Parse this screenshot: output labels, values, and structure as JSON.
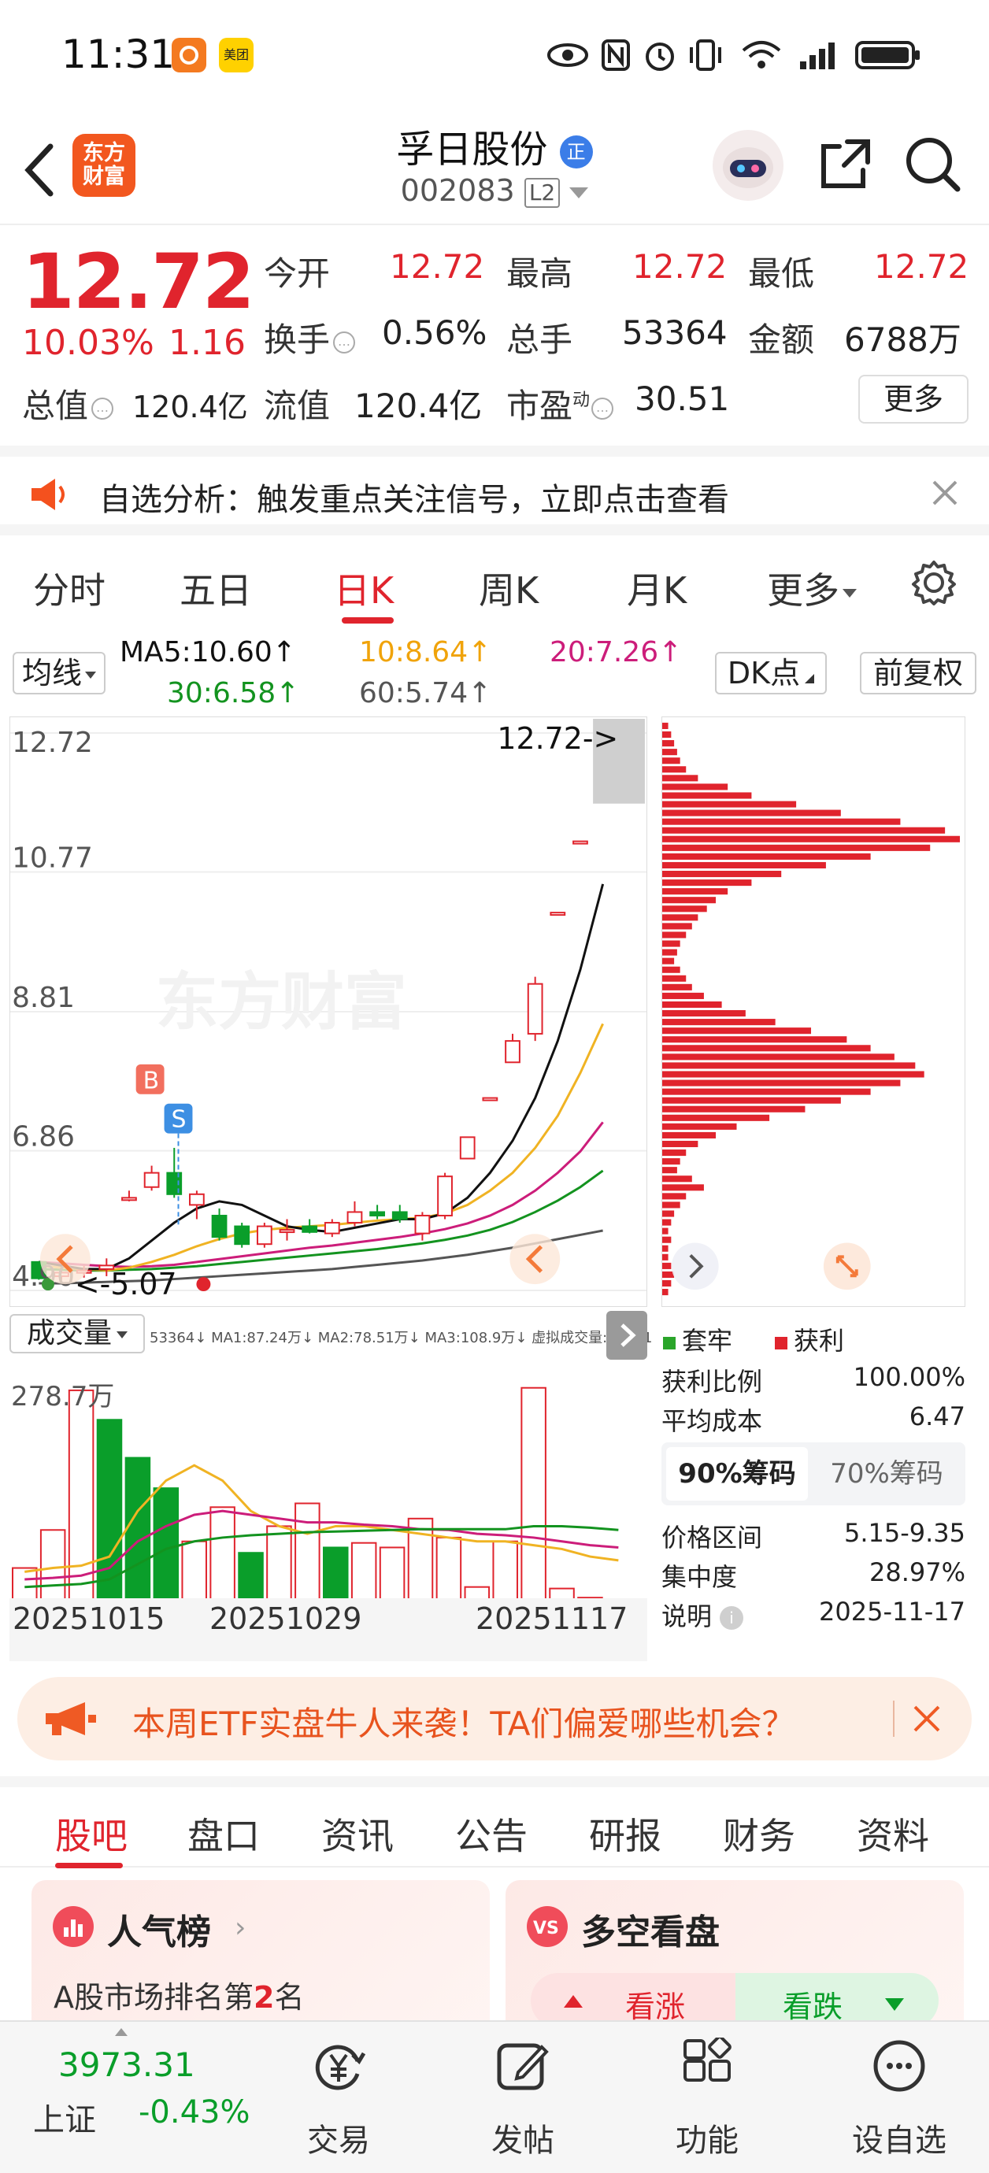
{
  "status_bar": {
    "time": "11:31",
    "app_badge_2_text": "美团"
  },
  "header": {
    "app_logo_text": "东方财富",
    "stock_name": "孚日股份",
    "stock_badge": "正",
    "stock_code": "002083",
    "level_badge": "L2"
  },
  "quote": {
    "price": "12.72",
    "change_pct": "10.03%",
    "change_amt": "1.16",
    "open_label": "今开",
    "open": "12.72",
    "high_label": "最高",
    "high": "12.72",
    "low_label": "最低",
    "low": "12.72",
    "turnover_label": "换手",
    "turnover": "0.56%",
    "volume_label": "总手",
    "volume": "53364",
    "amount_label": "金额",
    "amount": "6788万",
    "mktcap_label": "总值",
    "mktcap": "120.4亿",
    "float_label": "流值",
    "float_cap": "120.4亿",
    "pe_label": "市盈",
    "pe_super": "动",
    "pe": "30.51",
    "more_label": "更多"
  },
  "notice": {
    "text": "自选分析：触发重点关注信号，立即点击查看"
  },
  "period_tabs": [
    "分时",
    "五日",
    "日K",
    "周K",
    "月K",
    "更多"
  ],
  "period_active": "日K",
  "ma_legend": {
    "selector": "均线",
    "ma5": "MA5:10.60↑",
    "ma10": "10:8.64↑",
    "ma20": "20:7.26↑",
    "ma30": "30:6.58↑",
    "ma60": "60:5.74↑",
    "dk_button": "DK点",
    "adjust_button": "前复权"
  },
  "colors": {
    "up": "#e0242d",
    "down": "#0a9e2a",
    "ma5": "#111111",
    "ma10": "#f0b323",
    "ma20": "#cc1d7a",
    "ma30": "#13931f",
    "ma60": "#555555",
    "accent": "#e8531e"
  },
  "kline": {
    "price_labels": [
      "12.72",
      "10.77",
      "8.81",
      "6.86",
      "4.90"
    ],
    "last_price_tag": "12.72->",
    "low_tag": "<-5.07",
    "buy_marker": "B",
    "sell_marker": "S",
    "watermark": "东方财富",
    "candles": [
      {
        "o": 5.3,
        "h": 5.3,
        "l": 5.05,
        "c": 5.07
      },
      {
        "o": 5.1,
        "h": 5.2,
        "l": 5.05,
        "c": 5.15
      },
      {
        "o": 5.15,
        "h": 5.25,
        "l": 5.08,
        "c": 5.18
      },
      {
        "o": 5.2,
        "h": 5.35,
        "l": 5.1,
        "c": 5.25
      },
      {
        "o": 6.2,
        "h": 6.3,
        "l": 6.15,
        "c": 6.2
      },
      {
        "o": 6.35,
        "h": 6.65,
        "l": 6.3,
        "c": 6.55
      },
      {
        "o": 6.55,
        "h": 6.9,
        "l": 6.2,
        "c": 6.25
      },
      {
        "o": 6.1,
        "h": 6.3,
        "l": 5.9,
        "c": 6.25
      },
      {
        "o": 5.95,
        "h": 6.05,
        "l": 5.6,
        "c": 5.65
      },
      {
        "o": 5.8,
        "h": 5.85,
        "l": 5.5,
        "c": 5.55
      },
      {
        "o": 5.55,
        "h": 5.85,
        "l": 5.5,
        "c": 5.8
      },
      {
        "o": 5.75,
        "h": 5.9,
        "l": 5.6,
        "c": 5.75
      },
      {
        "o": 5.8,
        "h": 5.9,
        "l": 5.7,
        "c": 5.72
      },
      {
        "o": 5.7,
        "h": 5.9,
        "l": 5.65,
        "c": 5.85
      },
      {
        "o": 5.85,
        "h": 6.15,
        "l": 5.8,
        "c": 6.0
      },
      {
        "o": 6.0,
        "h": 6.1,
        "l": 5.9,
        "c": 5.95
      },
      {
        "o": 6.0,
        "h": 6.1,
        "l": 5.85,
        "c": 5.9
      },
      {
        "o": 5.7,
        "h": 6.0,
        "l": 5.6,
        "c": 5.95
      },
      {
        "o": 5.95,
        "h": 6.55,
        "l": 5.9,
        "c": 6.5
      },
      {
        "o": 6.75,
        "h": 7.05,
        "l": 6.75,
        "c": 7.05
      },
      {
        "o": 7.6,
        "h": 7.6,
        "l": 7.6,
        "c": 7.6
      },
      {
        "o": 8.1,
        "h": 8.5,
        "l": 8.1,
        "c": 8.4
      },
      {
        "o": 8.5,
        "h": 9.3,
        "l": 8.4,
        "c": 9.2
      },
      {
        "o": 10.2,
        "h": 10.2,
        "l": 10.2,
        "c": 10.2
      },
      {
        "o": 11.2,
        "h": 11.2,
        "l": 11.2,
        "c": 11.2
      },
      {
        "o": 12.72,
        "h": 12.72,
        "l": 12.72,
        "c": 12.72
      }
    ],
    "ma5": [
      5.3,
      5.25,
      5.2,
      5.2,
      5.35,
      5.6,
      5.85,
      6.05,
      6.15,
      6.1,
      5.95,
      5.8,
      5.75,
      5.72,
      5.78,
      5.84,
      5.9,
      5.9,
      5.98,
      6.2,
      6.55,
      7.0,
      7.6,
      8.4,
      9.4,
      10.6
    ],
    "ma10": [
      5.25,
      5.22,
      5.2,
      5.18,
      5.22,
      5.3,
      5.4,
      5.52,
      5.62,
      5.7,
      5.75,
      5.78,
      5.8,
      5.82,
      5.85,
      5.88,
      5.9,
      5.92,
      5.98,
      6.1,
      6.3,
      6.55,
      6.9,
      7.35,
      7.95,
      8.64
    ],
    "ma20": [
      5.3,
      5.28,
      5.26,
      5.24,
      5.23,
      5.24,
      5.26,
      5.3,
      5.34,
      5.38,
      5.42,
      5.46,
      5.5,
      5.53,
      5.57,
      5.61,
      5.65,
      5.7,
      5.76,
      5.84,
      5.95,
      6.1,
      6.3,
      6.55,
      6.85,
      7.26
    ],
    "ma30": [
      5.2,
      5.19,
      5.18,
      5.18,
      5.19,
      5.2,
      5.22,
      5.24,
      5.27,
      5.3,
      5.33,
      5.36,
      5.39,
      5.42,
      5.45,
      5.48,
      5.52,
      5.56,
      5.61,
      5.67,
      5.75,
      5.86,
      6.0,
      6.16,
      6.35,
      6.58
    ],
    "ma60": [
      5.0,
      5.0,
      5.01,
      5.02,
      5.03,
      5.04,
      5.06,
      5.08,
      5.1,
      5.12,
      5.14,
      5.16,
      5.18,
      5.2,
      5.23,
      5.26,
      5.29,
      5.32,
      5.36,
      5.4,
      5.45,
      5.5,
      5.56,
      5.62,
      5.68,
      5.74
    ]
  },
  "volume": {
    "selector": "成交量",
    "legend": "53364↓ MA1:87.24万↓ MA2:78.51万↓ MA3:108.9万↓ 虚拟成交量:71881",
    "max_label": "278.7万",
    "bars": [
      {
        "v": 45,
        "up": true
      },
      {
        "v": 95,
        "up": true
      },
      {
        "v": 278.7,
        "up": true
      },
      {
        "v": 240,
        "up": false
      },
      {
        "v": 190,
        "up": false
      },
      {
        "v": 150,
        "up": false
      },
      {
        "v": 80,
        "up": true
      },
      {
        "v": 125,
        "up": true
      },
      {
        "v": 65,
        "up": false
      },
      {
        "v": 100,
        "up": true
      },
      {
        "v": 130,
        "up": true
      },
      {
        "v": 72,
        "up": false
      },
      {
        "v": 78,
        "up": true
      },
      {
        "v": 72,
        "up": true
      },
      {
        "v": 110,
        "up": true
      },
      {
        "v": 85,
        "up": true
      },
      {
        "v": 20,
        "up": true
      },
      {
        "v": 80,
        "up": true
      },
      {
        "v": 282,
        "up": true
      },
      {
        "v": 18,
        "up": true
      },
      {
        "v": 6,
        "up": true
      },
      {
        "v": 4,
        "up": true
      }
    ],
    "dates": [
      "20251015",
      "20251029",
      "20251117"
    ]
  },
  "chips": {
    "legend_hold": "套牢",
    "legend_profit": "获利",
    "profit_ratio_label": "获利比例",
    "profit_ratio": "100.00%",
    "avg_cost_label": "平均成本",
    "avg_cost": "6.47",
    "tab_90": "90%筹码",
    "tab_70": "70%筹码",
    "price_range_label": "价格区间",
    "price_range": "5.15-9.35",
    "concentration_label": "集中度",
    "concentration": "28.97%",
    "note_label": "说明",
    "note_date": "2025-11-17"
  },
  "promo": {
    "text": "本周ETF实盘牛人来袭！TA们偏爱哪些机会？"
  },
  "content_tabs": [
    "股吧",
    "盘口",
    "资讯",
    "公告",
    "研报",
    "财务",
    "资料"
  ],
  "content_active": "股吧",
  "cards": {
    "popular_title": "人气榜",
    "popular_desc_prefix": "A股市场排名第",
    "popular_rank": "2",
    "popular_desc_suffix": "名",
    "bullbear_title": "多空看盘",
    "bullish_label": "看涨",
    "bearish_label": "看跌"
  },
  "bottom_bar": {
    "index_value": "3973.31",
    "index_name": "上证",
    "index_change": "-0.43%",
    "trade_label": "交易",
    "post_label": "发帖",
    "func_label": "功能",
    "watch_label": "设自选"
  }
}
